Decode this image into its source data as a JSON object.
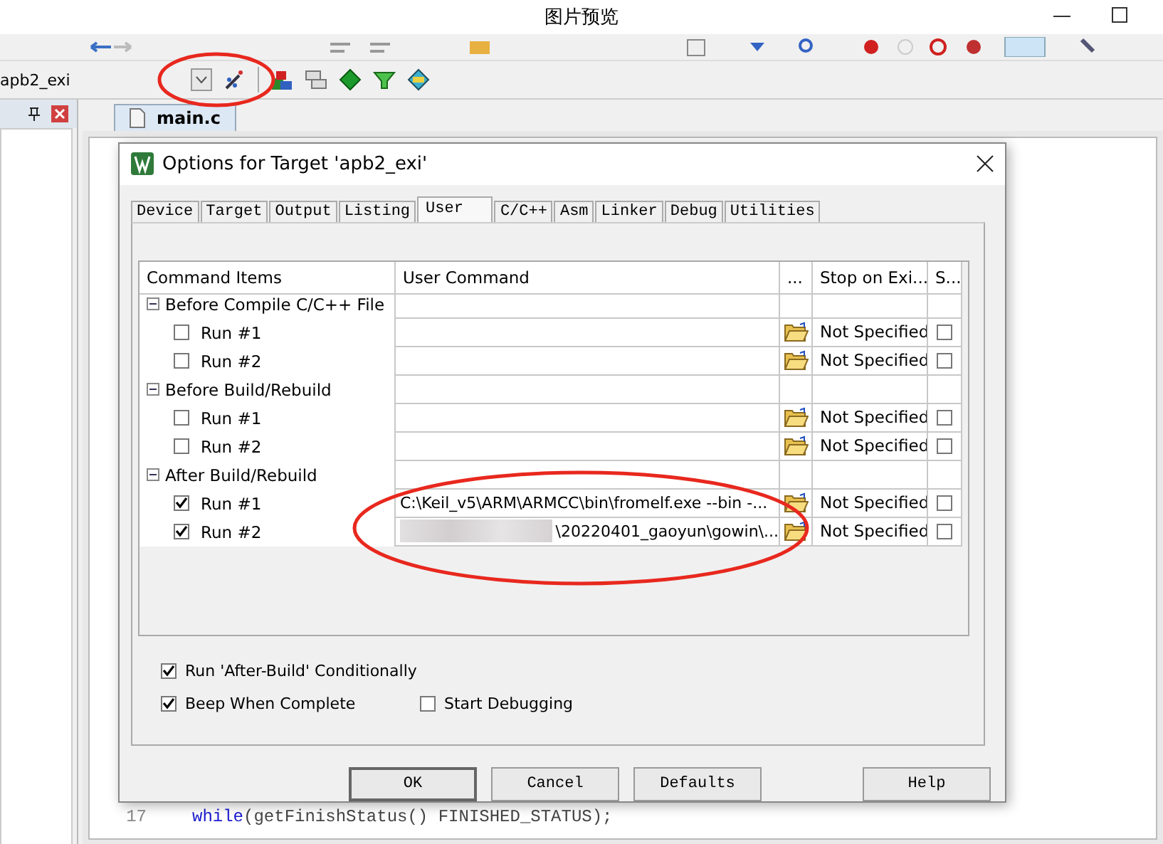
{
  "window": {
    "title": "图片预览"
  },
  "toolbar": {
    "target": "apb2_exi"
  },
  "editor": {
    "tab": "main.c",
    "code_lines": [
      {
        "number": "17",
        "keyword": "while",
        "text": "(getFinishStatus()  FINISHED_STATUS);"
      }
    ]
  },
  "dialog": {
    "title": "Options for Target 'apb2_exi'",
    "tabs": [
      {
        "label": "Device",
        "selected": false
      },
      {
        "label": "Target",
        "selected": false
      },
      {
        "label": "Output",
        "selected": false
      },
      {
        "label": "Listing",
        "selected": false
      },
      {
        "label": "User",
        "selected": true
      },
      {
        "label": "C/C++",
        "selected": false
      },
      {
        "label": "Asm",
        "selected": false
      },
      {
        "label": "Linker",
        "selected": false
      },
      {
        "label": "Debug",
        "selected": false
      },
      {
        "label": "Utilities",
        "selected": false
      }
    ],
    "table": {
      "columns": [
        "Command Items",
        "User Command",
        "...",
        "Stop on Exi...",
        "S..."
      ],
      "groups": [
        {
          "label": "Before Compile C/C++ File",
          "expanded": true,
          "children": [
            {
              "label": "Run #1",
              "checked": false,
              "redacted": false,
              "stop": "Not Specified",
              "s_checked": false
            },
            {
              "label": "Run #2",
              "checked": false,
              "redacted": false,
              "stop": "Not Specified",
              "s_checked": false
            }
          ]
        },
        {
          "label": "Before Build/Rebuild",
          "expanded": true,
          "children": [
            {
              "label": "Run #1",
              "checked": false,
              "redacted": false,
              "stop": "Not Specified",
              "s_checked": false
            },
            {
              "label": "Run #2",
              "checked": false,
              "redacted": false,
              "stop": "Not Specified",
              "s_checked": false
            }
          ]
        },
        {
          "label": "After Build/Rebuild",
          "expanded": true,
          "children": [
            {
              "label": "Run #1",
              "checked": true,
              "redacted": false,
              "command": "C:\\Keil_v5\\ARM\\ARMCC\\bin\\fromelf.exe --bin -...",
              "stop": "Not Specified",
              "s_checked": false
            },
            {
              "label": "Run #2",
              "checked": true,
              "redacted": true,
              "command": "\\20220401_gaoyun\\gowin\\...",
              "stop": "Not Specified",
              "s_checked": false
            }
          ]
        }
      ]
    },
    "options": [
      [
        {
          "label": "Run 'After-Build' Conditionally",
          "checked": true
        }
      ],
      [
        {
          "label": "Beep When Complete",
          "checked": true
        },
        {
          "label": "Start Debugging",
          "checked": false
        }
      ]
    ],
    "buttons": [
      "OK",
      "Cancel",
      "Defaults",
      "Help"
    ]
  }
}
